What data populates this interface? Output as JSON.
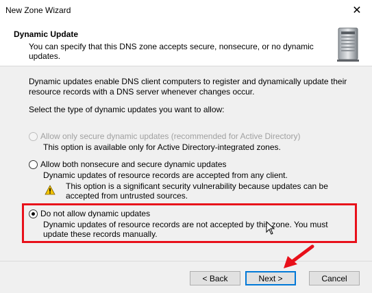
{
  "window": {
    "title": "New Zone Wizard"
  },
  "header": {
    "title": "Dynamic Update",
    "subtitle": "You can specify that this DNS zone accepts secure, nonsecure, or no dynamic updates."
  },
  "content": {
    "intro": "Dynamic updates enable DNS client computers to register and dynamically update their resource records with a DNS server whenever changes occur.",
    "select_label": "Select the type of dynamic updates you want to allow:",
    "options": [
      {
        "label": "Allow only secure dynamic updates (recommended for Active Directory)",
        "description": "This option is available only for Active Directory-integrated zones.",
        "enabled": false,
        "selected": false
      },
      {
        "label": "Allow both nonsecure and secure dynamic updates",
        "description": "Dynamic updates of resource records are accepted from any client.",
        "warning": "This option is a significant security vulnerability because updates can be accepted from untrusted sources.",
        "enabled": true,
        "selected": false
      },
      {
        "label": "Do not allow dynamic updates",
        "description": "Dynamic updates of resource records are not accepted by this zone. You must update these records manually.",
        "enabled": true,
        "selected": true
      }
    ]
  },
  "footer": {
    "back": "< Back",
    "next": "Next >",
    "cancel": "Cancel"
  },
  "icons": {
    "close": "close-icon",
    "server": "server-icon",
    "warning": "warning-icon"
  },
  "colors": {
    "highlight": "#e8101a",
    "accent": "#0078d7",
    "panel": "#f0f0f0"
  }
}
